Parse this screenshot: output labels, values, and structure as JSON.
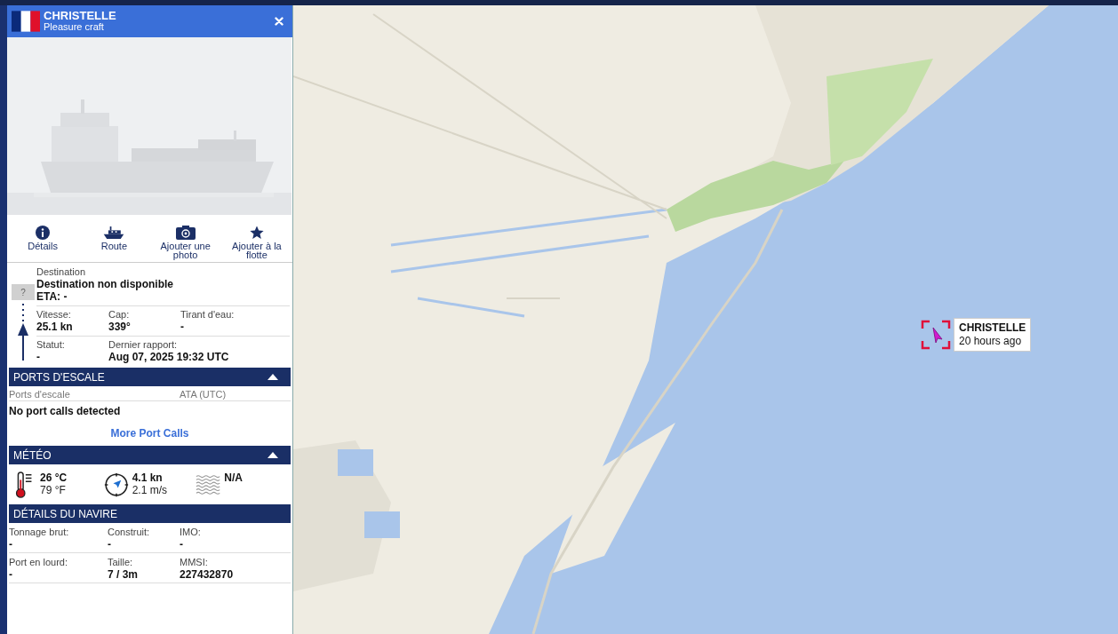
{
  "vessel_header": {
    "name": "CHRISTELLE",
    "type": "Pleasure craft"
  },
  "actions": [
    {
      "kind": "info",
      "label": "Détails"
    },
    {
      "kind": "ship",
      "label": "Route"
    },
    {
      "kind": "camera",
      "label": "Ajouter une photo"
    },
    {
      "kind": "star",
      "label": "Ajouter à la flotte"
    }
  ],
  "voyage": {
    "destination_label": "Destination",
    "destination_flag": "?",
    "destination": "Destination non disponible",
    "eta": "ETA: -",
    "rows": [
      [
        {
          "label": "Vitesse:",
          "value": "25.1 kn"
        },
        {
          "label": "Cap:",
          "value": "339°"
        },
        {
          "label": "Tirant d'eau:",
          "value": "-"
        }
      ],
      [
        {
          "label": "Statut:",
          "value": "-"
        },
        {
          "label": "Dernier rapport:",
          "value": "Aug 07, 2025 19:32 UTC"
        }
      ]
    ]
  },
  "port_calls": {
    "title": "PORTS D'ESCALE",
    "expanded": true,
    "columns": [
      "Ports d'escale",
      "ATA (UTC)"
    ],
    "message": "No port calls detected",
    "link": "More Port Calls"
  },
  "weather": {
    "title": "MÉTÉO",
    "expanded": true,
    "items": [
      {
        "kind": "temperature",
        "primary": "26 °C",
        "secondary": "79 °F"
      },
      {
        "kind": "wind",
        "primary": "4.1 kn",
        "secondary": "2.1 m/s"
      },
      {
        "kind": "waves",
        "primary": "N/A"
      }
    ]
  },
  "vessel_details": {
    "title": "DÉTAILS DU NAVIRE",
    "rows": [
      [
        {
          "label": "Tonnage brut:",
          "value": "-"
        },
        {
          "label": "Construit:",
          "value": "-"
        },
        {
          "label": "IMO:",
          "value": "-"
        }
      ],
      [
        {
          "label": "Port en lourd:",
          "value": "-"
        },
        {
          "label": "Taille:",
          "value": "7 / 3m"
        },
        {
          "label": "MMSI:",
          "value": "227432870"
        }
      ]
    ]
  },
  "map_marker": {
    "name": "CHRISTELLE",
    "time": "20 hours ago"
  }
}
